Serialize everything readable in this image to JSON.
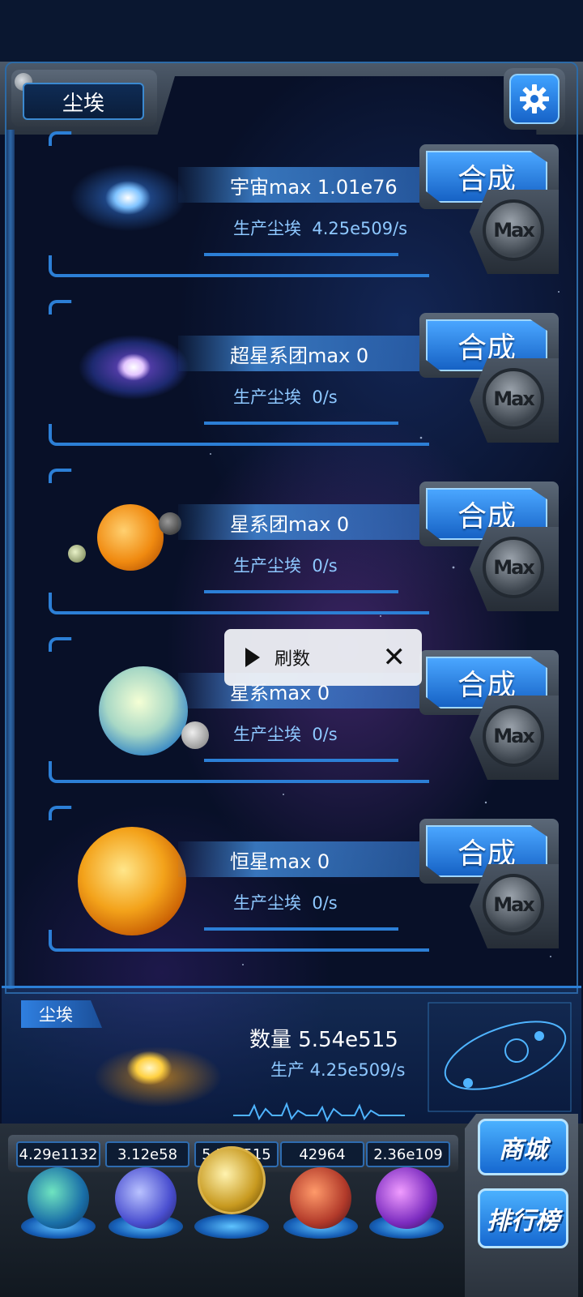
{
  "header": {
    "title": "尘埃",
    "settings_icon": "gear-icon"
  },
  "rows": [
    {
      "name": "宇宙max 1.01e76",
      "production": "生产尘埃  4.25e509/s",
      "merge_label": "合成",
      "max_label": "Max",
      "planet": "universe"
    },
    {
      "name": "超星系团max 0",
      "production": "生产尘埃  0/s",
      "merge_label": "合成",
      "max_label": "Max",
      "planet": "supercluster"
    },
    {
      "name": "星系团max 0",
      "production": "生产尘埃  0/s",
      "merge_label": "合成",
      "max_label": "Max",
      "planet": "galaxy-cluster"
    },
    {
      "name": "星系max 0",
      "production": "生产尘埃  0/s",
      "merge_label": "合成",
      "max_label": "Max",
      "planet": "galaxy"
    },
    {
      "name": "恒星max 0",
      "production": "生产尘埃  0/s",
      "merge_label": "合成",
      "max_label": "Max",
      "planet": "star"
    }
  ],
  "ad_popup": {
    "label": "刷数",
    "play_icon": "play-icon",
    "close_icon": "close-icon"
  },
  "resource": {
    "tag": "尘埃",
    "count": "数量 5.54e515",
    "production": "生产 4.25e509/s"
  },
  "dock": {
    "cells": [
      "4.29e1132",
      "3.12e58",
      "5.54e515",
      "42964",
      "2.36e109"
    ],
    "orbs": [
      "atom-orb",
      "lightning-orb",
      "dust-orb",
      "neuron-orb",
      "vortex-orb"
    ],
    "shop_label": "商城",
    "rank_label": "排行榜"
  }
}
